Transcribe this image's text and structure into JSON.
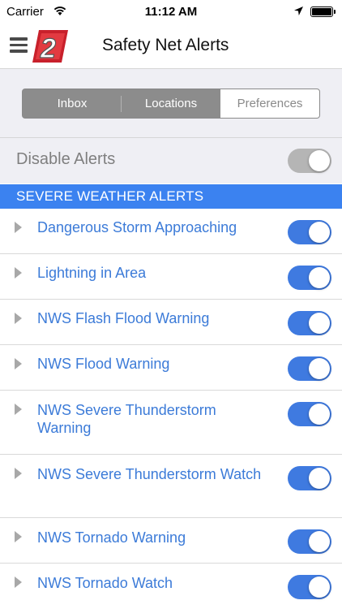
{
  "status_bar": {
    "carrier": "Carrier",
    "time": "11:12 AM"
  },
  "header": {
    "logo_text": "2",
    "title": "Safety Net Alerts"
  },
  "tabs": [
    {
      "label": "Inbox",
      "active": false
    },
    {
      "label": "Locations",
      "active": false
    },
    {
      "label": "Preferences",
      "active": true
    }
  ],
  "disable_alerts": {
    "label": "Disable Alerts",
    "enabled": true
  },
  "section": {
    "title": "SEVERE WEATHER ALERTS"
  },
  "alerts": [
    {
      "label": "Dangerous Storm Approaching",
      "enabled": true
    },
    {
      "label": "Lightning in Area",
      "enabled": true
    },
    {
      "label": "NWS Flash Flood Warning",
      "enabled": true
    },
    {
      "label": "NWS Flood Warning",
      "enabled": true
    },
    {
      "label": "NWS Severe Thunderstorm Warning",
      "enabled": true
    },
    {
      "label": "NWS Severe Thunderstorm Watch",
      "enabled": true
    },
    {
      "label": "NWS Tornado Warning",
      "enabled": true
    },
    {
      "label": "NWS Tornado Watch",
      "enabled": true
    }
  ],
  "colors": {
    "accent": "#3b82f0",
    "toggle_on": "#3f7ae0",
    "alert_text": "#3c7bd8",
    "logo_red": "#c8202b"
  }
}
